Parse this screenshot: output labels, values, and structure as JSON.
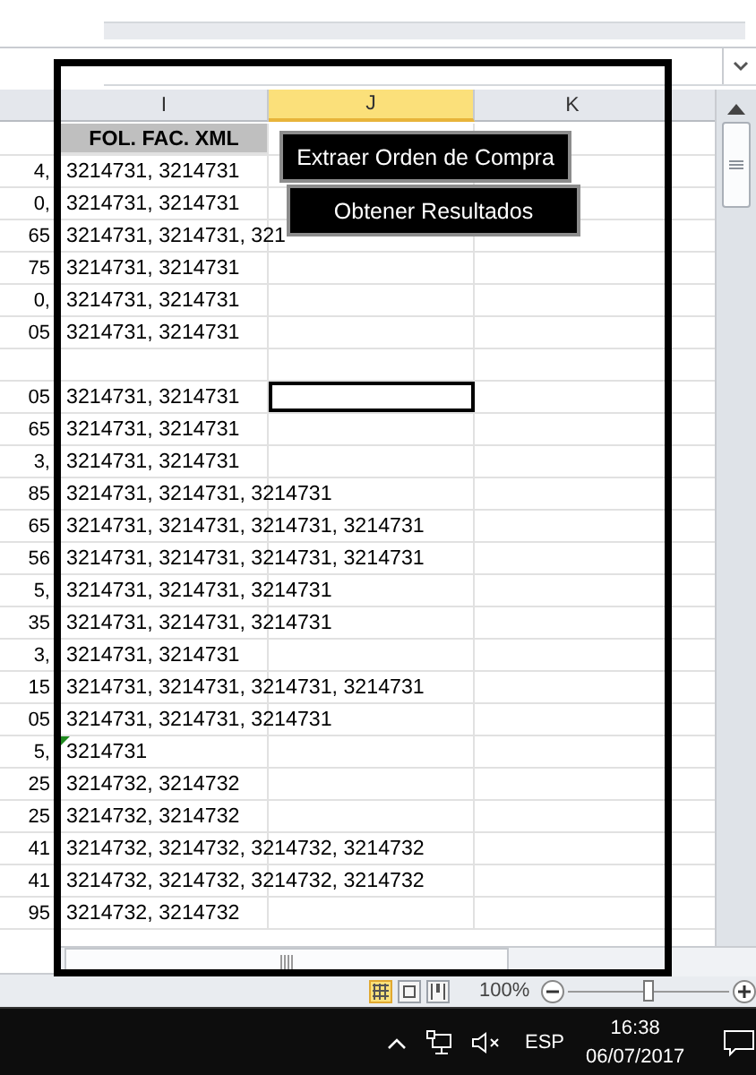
{
  "columns": [
    {
      "label": "I",
      "selected": false
    },
    {
      "label": "J",
      "selected": true
    },
    {
      "label": "K",
      "selected": false
    }
  ],
  "header_cell": "FOL. FAC. XML",
  "rows": [
    {
      "column_h": "4,",
      "fol": "3214731, 3214731",
      "flagged": false,
      "j_selected": false
    },
    {
      "column_h": "0,",
      "fol": "3214731, 3214731",
      "flagged": false,
      "j_selected": false
    },
    {
      "column_h": "65",
      "fol": "3214731, 3214731, 321",
      "flagged": false,
      "j_selected": false
    },
    {
      "column_h": "75",
      "fol": "3214731, 3214731",
      "flagged": false,
      "j_selected": false
    },
    {
      "column_h": "0,",
      "fol": "3214731, 3214731",
      "flagged": false,
      "j_selected": false
    },
    {
      "column_h": "05",
      "fol": "3214731, 3214731",
      "flagged": false,
      "j_selected": false
    },
    {
      "flagged": false,
      "j_selected": false
    },
    {
      "column_h": "05",
      "fol": "3214731, 3214731",
      "flagged": false,
      "j_selected": true
    },
    {
      "column_h": "65",
      "fol": "3214731, 3214731",
      "flagged": false,
      "j_selected": false
    },
    {
      "column_h": "3,",
      "fol": "3214731, 3214731",
      "flagged": false,
      "j_selected": false
    },
    {
      "column_h": "85",
      "fol": "3214731, 3214731, 3214731",
      "flagged": false,
      "j_selected": false
    },
    {
      "column_h": "65",
      "fol": "3214731, 3214731, 3214731, 3214731",
      "flagged": false,
      "j_selected": false
    },
    {
      "column_h": "56",
      "fol": "3214731, 3214731, 3214731, 3214731",
      "flagged": false,
      "j_selected": false
    },
    {
      "column_h": "5,",
      "fol": "3214731, 3214731, 3214731",
      "flagged": false,
      "j_selected": false
    },
    {
      "column_h": "35",
      "fol": "3214731, 3214731, 3214731",
      "flagged": false,
      "j_selected": false
    },
    {
      "column_h": "3,",
      "fol": "3214731, 3214731",
      "flagged": false,
      "j_selected": false
    },
    {
      "column_h": "15",
      "fol": "3214731, 3214731, 3214731, 3214731",
      "flagged": false,
      "j_selected": false
    },
    {
      "column_h": "05",
      "fol": "3214731, 3214731, 3214731",
      "flagged": false,
      "j_selected": false
    },
    {
      "column_h": "5,",
      "fol": "3214731",
      "flagged": true,
      "j_selected": false
    },
    {
      "column_h": "25",
      "fol": "3214732, 3214732",
      "flagged": false,
      "j_selected": false
    },
    {
      "column_h": "25",
      "fol": "3214732, 3214732",
      "flagged": false,
      "j_selected": false
    },
    {
      "column_h": "41",
      "fol": "3214732, 3214732, 3214732, 3214732",
      "flagged": false,
      "j_selected": false
    },
    {
      "column_h": "41",
      "fol": "3214732, 3214732, 3214732, 3214732",
      "flagged": false,
      "j_selected": false
    },
    {
      "column_h": "95",
      "fol": "3214732, 3214732",
      "flagged": false,
      "j_selected": false
    }
  ],
  "buttons": [
    "Extraer Orden de Compra",
    "Obtener Resultados"
  ],
  "status_bar": {
    "views": [
      {
        "kind": "normal",
        "selected": true
      },
      {
        "kind": "layout",
        "selected": false
      },
      {
        "kind": "pagebreak",
        "selected": false
      }
    ],
    "zoom": "100%",
    "zoom_slider": {
      "level": 0.5
    }
  },
  "taskbar": {
    "muted": true,
    "language": "ESP",
    "time": "16:38",
    "date": "06/07/2017"
  }
}
